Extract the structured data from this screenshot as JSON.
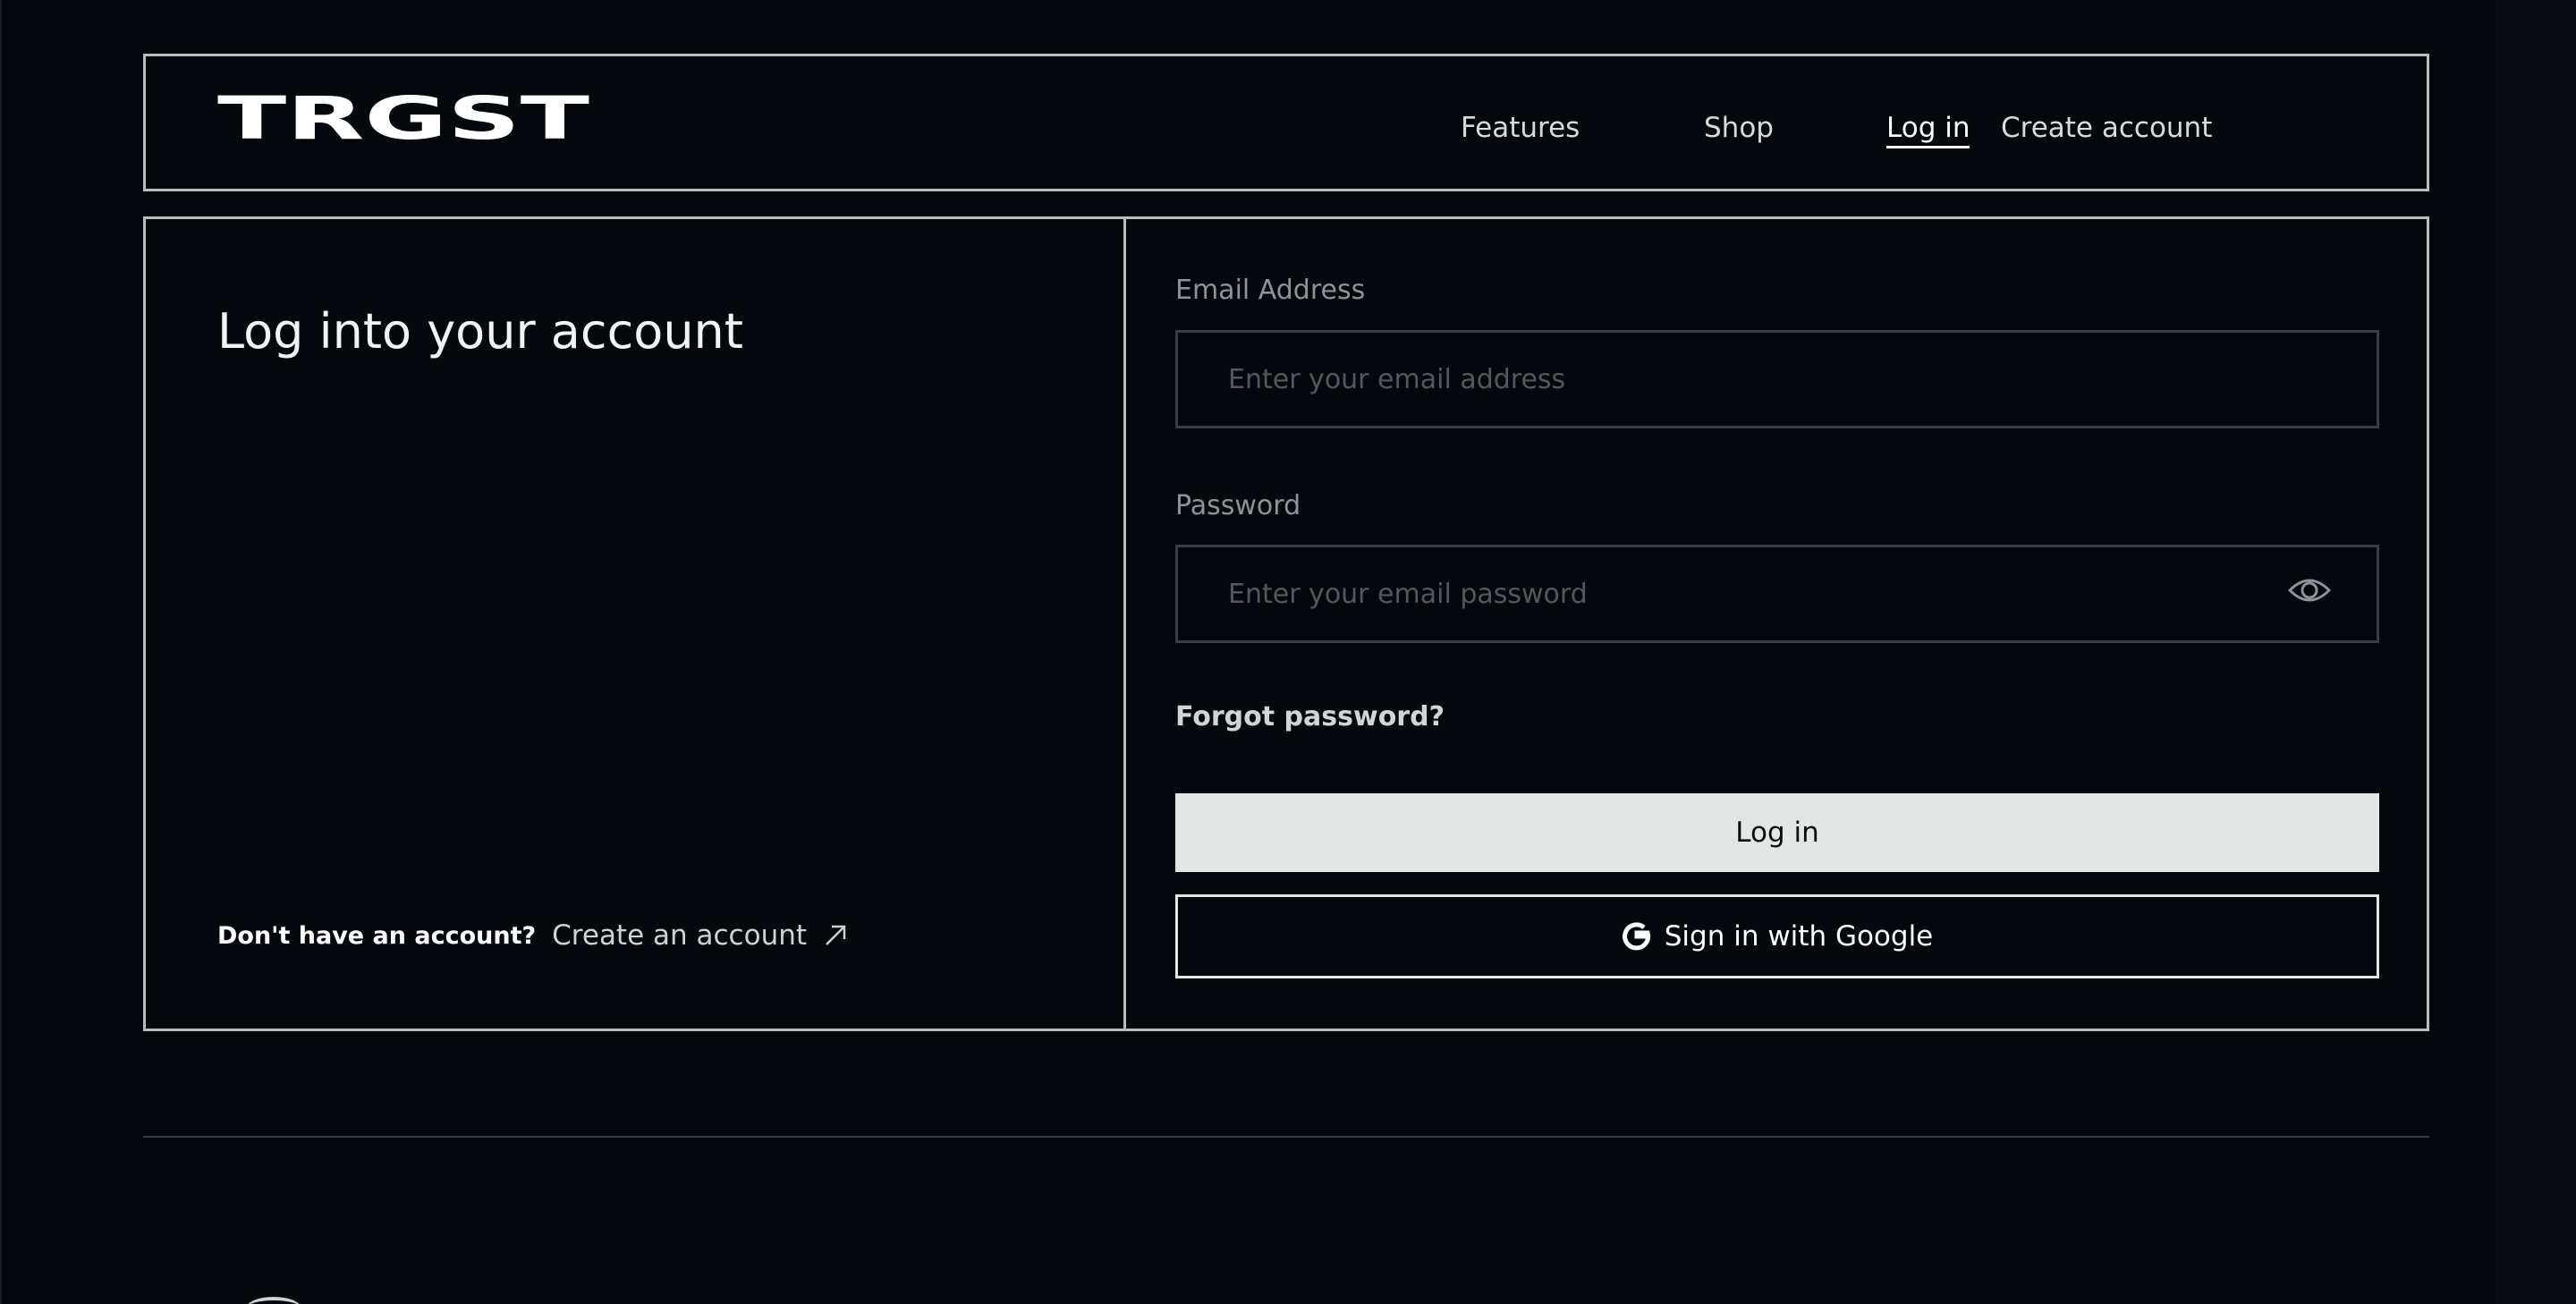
{
  "header": {
    "logo_text": "TRGST",
    "nav": [
      "Features",
      "Shop",
      "Log in",
      "Create account"
    ]
  },
  "left": {
    "title": "Log into your account",
    "signup_question": "Don't have an account?",
    "signup_link": "Create an account"
  },
  "form": {
    "email_label": "Email Address",
    "email_placeholder": "Enter your email address",
    "password_label": "Password",
    "password_placeholder": "Enter your email password",
    "forgot": "Forgot password?",
    "login_button": "Log in",
    "google_button": "Sign in with Google"
  }
}
